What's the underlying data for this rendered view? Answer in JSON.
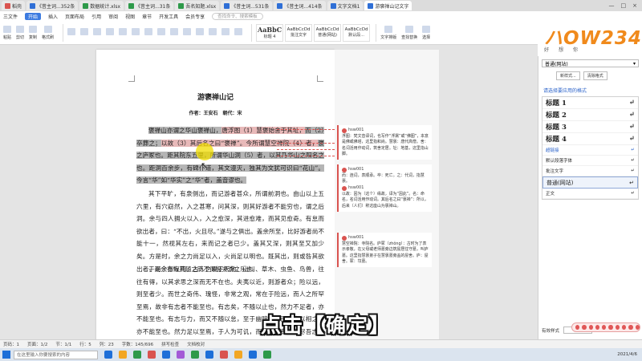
{
  "tabs": {
    "items": [
      {
        "label": "稻壳",
        "color": "#d9534f"
      },
      {
        "label": "《昔主词...352条",
        "color": "#2f6fd6"
      },
      {
        "label": "数据统计.xlsx",
        "color": "#2e9a4a"
      },
      {
        "label": "《昔主词...31条",
        "color": "#2e9a4a"
      },
      {
        "label": "吾名知题.xlsx",
        "color": "#2e9a4a"
      },
      {
        "label": "《昔主词...531条",
        "color": "#2f6fd6"
      },
      {
        "label": "《昔主词...414条",
        "color": "#2f6fd6"
      },
      {
        "label": "文字文档1",
        "color": "#2f6fd6"
      },
      {
        "label": "游褒禅山记文字",
        "color": "#2f6fd6"
      }
    ],
    "active_index": 8
  },
  "menubar": {
    "items": [
      "三文件",
      "开始",
      "插入",
      "页面布局",
      "引用",
      "审阅",
      "视图",
      "章节",
      "开发工具",
      "会员专享"
    ],
    "active": "开始",
    "search_placeholder": "查找命令、搜索模板"
  },
  "ribbon": {
    "buttons": [
      "粘贴",
      "剪切",
      "复制",
      "格式刷"
    ],
    "styles": [
      {
        "preview": "AaBbC",
        "name": "标题 4"
      },
      {
        "preview": "AaBbCcDd",
        "name": "批注文字"
      },
      {
        "preview": "AaBbCcDd",
        "name": "普通(网站)"
      },
      {
        "preview": "AaBbCcDd",
        "name": "默认段..."
      }
    ],
    "right_buttons": [
      "文字排版",
      "查找替换",
      "选择"
    ]
  },
  "brand": {
    "logo": "ハOW234",
    "sub": [
      "好",
      "想",
      "你"
    ]
  },
  "document": {
    "title": "游褒禅山记",
    "author_line": "作者：王安石　朝代：宋",
    "para1_pre": "褒禅山亦谓之华山褒禅山，",
    "para1_r1": "唐浮图（1）慧褒始舍于其址，",
    "para1_mid1": "而（2）卒葬之；",
    "para1_r2": "以故（3）其后名之曰“褒禅”。",
    "para1_r3": "今所谓慧空禅院（4）者，",
    "para1_post": "褒之庐冢也。距其院东五里，所谓华山洞（5）者，以其乃华山之阳名之也。距洞百余步，有碑仆道，其文漫灭，独其为文犹可识曰“花山”。今言“华”如“华实”之“华”者，盖音谬也。",
    "para2": "其下平旷，有泉侧出，而记游者甚众，所谓前洞也。由山以上五六里，有穴窈然，入之甚寒，问其深，则其好游者不能穷也，谓之后洞。余与四人拥火以入，入之愈深，其进愈难，而其见愈奇。有怠而欲出者，曰：“不出，火且尽。”遂与之俱出。盖余所至，比好游者尚不能十一，然视其左右，来而记之者已少。盖其又深，则其至又加少矣。方是时，余之力尚足以入，火尚足以明也。既其出，则或咎其欲出者，而余亦悔其随之而不得极夫游之乐也。",
    "para3": "于是余有叹焉。古人之观于天地、山川、草木、虫鱼、鸟兽，往往有得，以其求思之深而无不在也。夫夷以近，则游者众；险以远，则至者少。而世之奇伟、瑰怪，非常之观，常在于险远，而人之所罕至焉，故非有志者不能至也。有志矣，不随以止也，然力不足者，亦不能至也。有志与力，而又不随以怠，至于幽暗昏惑而无物以相之，亦不能至也。然力足以至焉，于人为可讥，而在己为有悔；尽吾志也而不能至者，可以无悔矣，其孰能讥之乎？此余之所得也。"
  },
  "comments": [
    {
      "user": "hsw001",
      "text": "浮图：梵文音译词，也写作“浮屠”或“佛图”，本意是佛或佛塔，这里指和尚。慧褒：唐代高僧。舍：名词活用作动词，筑舍定居。址：地基，这里指山脚。"
    },
    {
      "user": "hsw001",
      "text": "而：连词，表顺承。卒：死亡。之：代词，指慧褒。"
    },
    {
      "user": "hsw001",
      "text": "以故：因为（这个）缘故，译为“因此”。名：命名，名词活用作动词。其后名之曰“褒禅”：所以，后来（人们）称这座山为褒禅山。"
    },
    {
      "user": "hsw001",
      "text": "慧空禅院：寺院名。庐冢（zhǒng）：古时为了表示孝敬，在父母或老师墓旁边筑屋居住守墓，叫庐墓。这里指慧褒弟子在慧褒墓旁盖的屋舍。庐：屋舍。冢：坟墓。"
    }
  ],
  "side_panel": {
    "current_style": "普通(网站)",
    "buttons": [
      "新样式...",
      "清除格式"
    ],
    "link": "请选择要应用的格式",
    "styles": [
      {
        "name": "标题 1",
        "kind": "h"
      },
      {
        "name": "标题 2",
        "kind": "h"
      },
      {
        "name": "标题 3",
        "kind": "h"
      },
      {
        "name": "标题 4",
        "kind": "h"
      },
      {
        "name": "超链接",
        "kind": "link"
      },
      {
        "name": "默认段落字体",
        "kind": "small"
      },
      {
        "name": "批注文字",
        "kind": "small"
      },
      {
        "name": "普通(网站)",
        "kind": "sel"
      },
      {
        "name": "正文",
        "kind": "small"
      }
    ],
    "footer_label": "有效样式"
  },
  "caption": "点击【确定】",
  "statusbar": {
    "items": [
      "页码：1",
      "页面：1/2",
      "节：1/1",
      "行：5",
      "列：23",
      "字数：145/696",
      "拼写检查",
      "文档校对"
    ]
  },
  "taskbar": {
    "search_placeholder": "在这里输入你要搜索的内容",
    "apps": [
      "#1e6fd8",
      "#f2a623",
      "#2e9a4a",
      "#d9534f",
      "#1e6fd8",
      "#a35ad6",
      "#2e9a4a",
      "#1e6fd8",
      "#d9534f",
      "#f2a623",
      "#1e6fd8",
      "#2e9a4a"
    ],
    "date": "2021/4/6"
  },
  "colors": {
    "accent": "#3c7be0",
    "comment": "#d9534f",
    "logo": "#f08a1c"
  }
}
